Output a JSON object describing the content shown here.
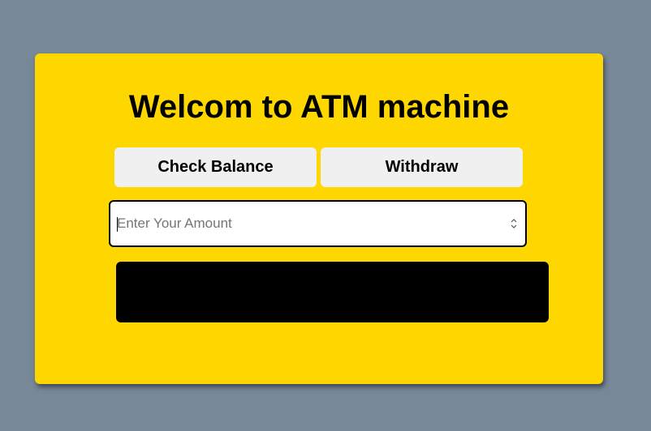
{
  "header": {
    "title": "Welcom to ATM machine"
  },
  "actions": {
    "check_balance_label": "Check Balance",
    "withdraw_label": "Withdraw"
  },
  "amount": {
    "value": "",
    "placeholder": "Enter Your Amount"
  },
  "result": {
    "text": ""
  },
  "colors": {
    "page_background": "#778899",
    "card_background": "#FFD700",
    "button_background": "#F0F0F0",
    "result_background": "#000000"
  },
  "icons": {
    "stepper": "spinner-arrows-icon"
  }
}
